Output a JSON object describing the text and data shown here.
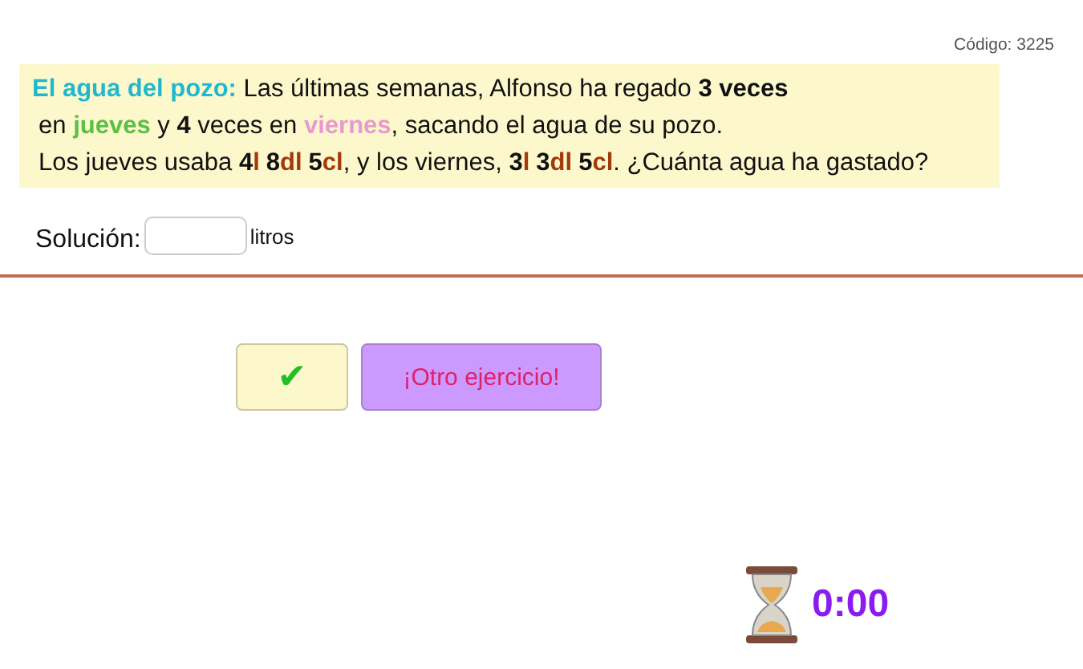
{
  "code": "Código: 3225",
  "problem": [
    [
      {
        "kind": "title",
        "text": "El agua del pozo:"
      },
      {
        "kind": "text",
        "text": " Las últimas semanas, Alfonso ha regado "
      },
      {
        "kind": "bold",
        "text": "3 veces"
      }
    ],
    [
      {
        "kind": "text",
        "text": "en "
      },
      {
        "kind": "jueves",
        "text": "jueves"
      },
      {
        "kind": "text",
        "text": " y "
      },
      {
        "kind": "bold",
        "text": "4"
      },
      {
        "kind": "text",
        "text": " veces en "
      },
      {
        "kind": "viernes",
        "text": "viernes"
      },
      {
        "kind": "text",
        "text": ", sacando el agua de su pozo."
      }
    ],
    [
      {
        "kind": "text",
        "text": "Los jueves usaba "
      },
      {
        "kind": "bold",
        "text": "4"
      },
      {
        "kind": "unit",
        "text": "l"
      },
      {
        "kind": "qty",
        "text": "8"
      },
      {
        "kind": "unit",
        "text": "dl"
      },
      {
        "kind": "qty",
        "text": "5"
      },
      {
        "kind": "unit",
        "text": "cl"
      },
      {
        "kind": "text",
        "text": ", y los viernes, "
      },
      {
        "kind": "bold",
        "text": "3"
      },
      {
        "kind": "unit",
        "text": "l"
      },
      {
        "kind": "qty",
        "text": "3"
      },
      {
        "kind": "unit",
        "text": "dl"
      },
      {
        "kind": "qty",
        "text": "5"
      },
      {
        "kind": "unit",
        "text": "cl"
      },
      {
        "kind": "text",
        "text": ". ¿Cuánta agua ha gastado?"
      }
    ]
  ],
  "solution": {
    "label": "Solución:",
    "unit": "litros"
  },
  "check_button": "✔",
  "next_button": "¡Otro ejercicio!",
  "timer": "0:00"
}
